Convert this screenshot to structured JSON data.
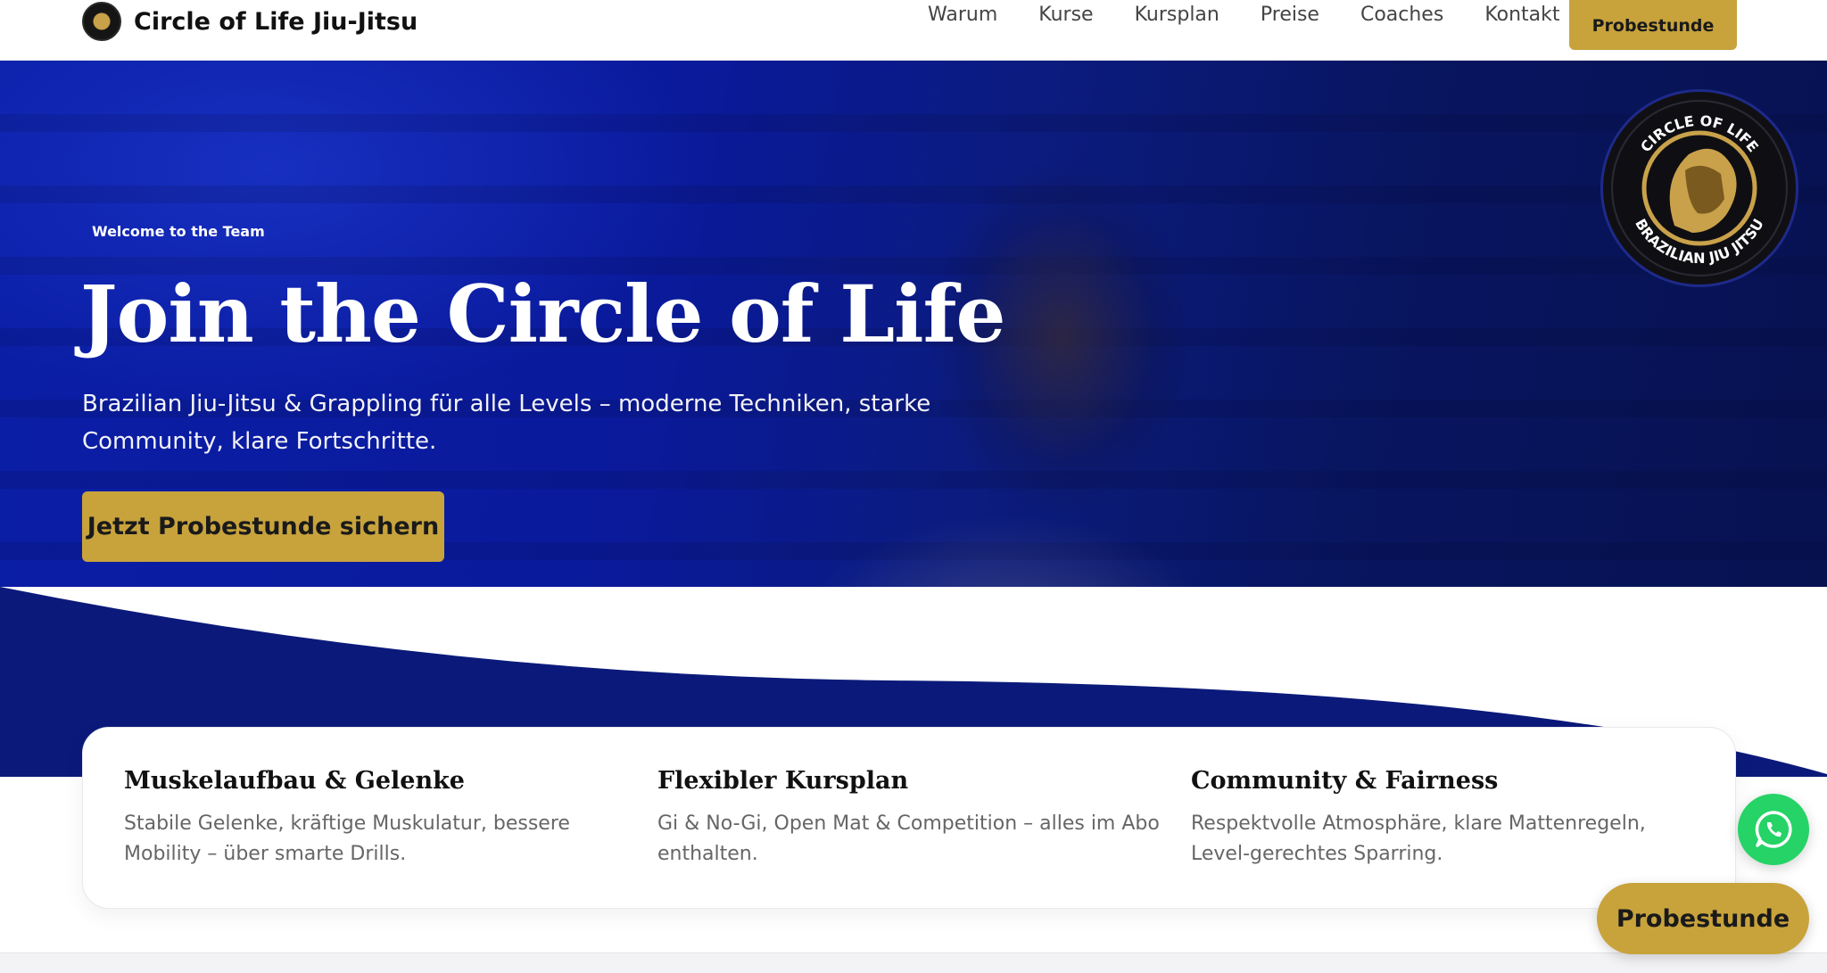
{
  "brand": {
    "name": "Circle of Life Jiu-Jitsu",
    "logo_icon": "lion-logo-icon"
  },
  "nav": {
    "links": [
      "Warum",
      "Kurse",
      "Kursplan",
      "Preise",
      "Coaches",
      "Kontakt"
    ],
    "cta": "Probestunde"
  },
  "hero": {
    "eyebrow": "Welcome to the Team",
    "title": "Join the Circle of Life",
    "subtitle": "Brazilian Jiu-Jitsu & Grappling für alle Levels – moderne Techniken, starke Community, klare Fortschritte.",
    "cta": "Jetzt Probestunde sichern",
    "seal": {
      "top_text": "CIRCLE OF LIFE",
      "bottom_text": "BRAZILIAN JIU JITSU",
      "icon": "lion-head-icon"
    }
  },
  "features": [
    {
      "title": "Muskelaufbau & Gelenke",
      "text": "Stabile Gelenke, kräftige Muskulatur, bessere Mobility – über smarte Drills."
    },
    {
      "title": "Flexibler Kursplan",
      "text": "Gi & No-Gi, Open Mat & Competition – alles im Abo enthalten."
    },
    {
      "title": "Community & Fairness",
      "text": "Respektvolle Atmosphäre, klare Mattenregeln, Level-gerechtes Sparring."
    }
  ],
  "floating": {
    "whatsapp_icon": "whatsapp-icon",
    "cta": "Probestunde"
  },
  "colors": {
    "accent": "#c8a33c",
    "hero_blue": "#0a1ea6",
    "whatsapp": "#25d366"
  }
}
